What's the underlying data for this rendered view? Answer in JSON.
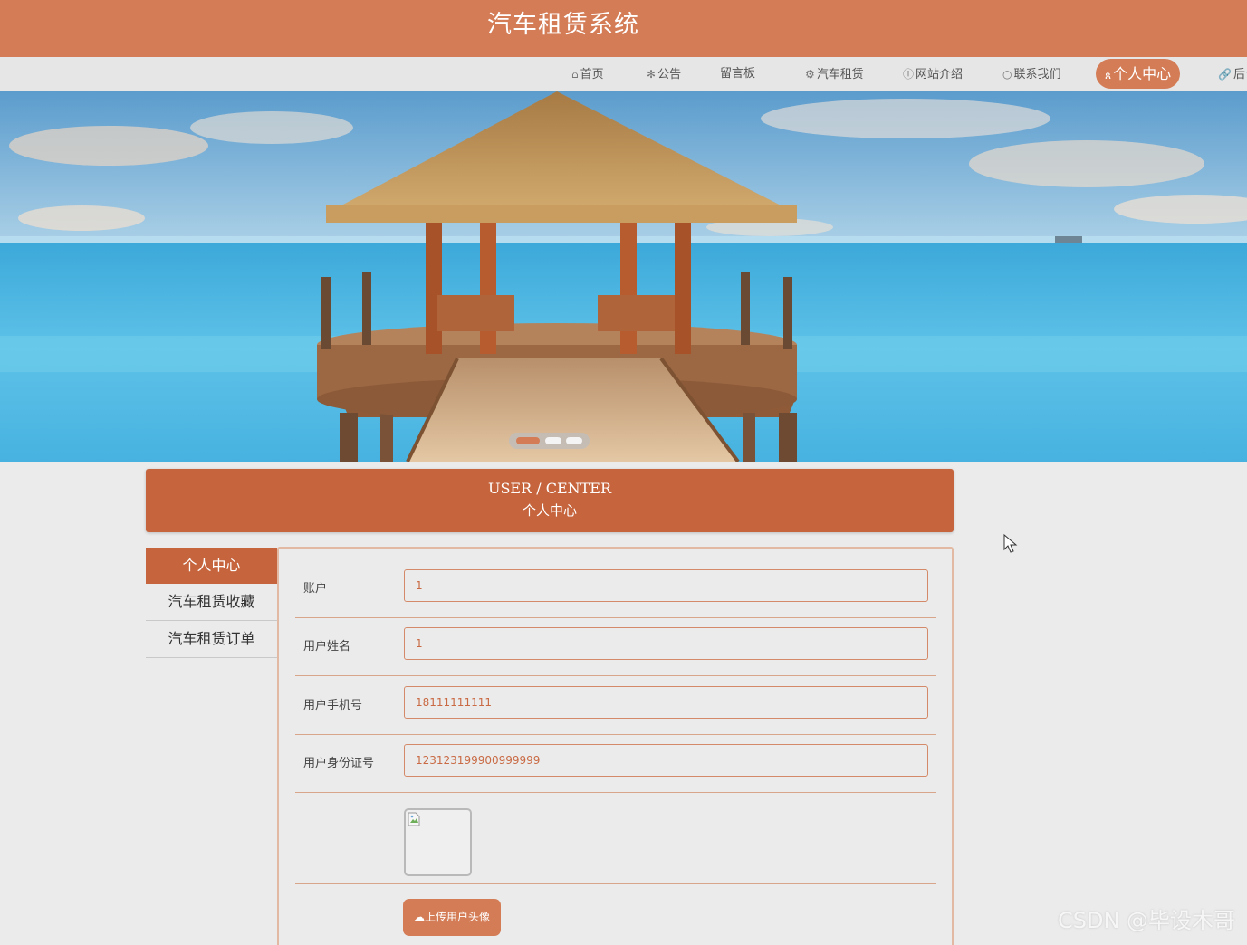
{
  "header": {
    "site_title": "汽车租赁系统"
  },
  "nav": {
    "items": [
      {
        "icon": "home-icon",
        "glyph": "⌂",
        "label": "首页"
      },
      {
        "icon": "notice-icon",
        "glyph": "✻",
        "label": "公告"
      },
      {
        "icon": "message-icon",
        "glyph": "",
        "label": "留言板"
      },
      {
        "icon": "car-icon",
        "glyph": "⚙",
        "label": "汽车租赁"
      },
      {
        "icon": "info-icon",
        "glyph": "ⓘ",
        "label": "网站介绍"
      },
      {
        "icon": "contact-icon",
        "glyph": "○",
        "label": "联系我们"
      },
      {
        "icon": "user-icon",
        "glyph": "ጰ",
        "label": "个人中心"
      },
      {
        "icon": "link-icon",
        "glyph": "🔗",
        "label": "后台"
      }
    ],
    "active_index": 6
  },
  "carousel": {
    "slide_count": 3,
    "active_slide": 1
  },
  "user_center": {
    "title_en": "USER / CENTER",
    "title_cn": "个人中心"
  },
  "sidebar": {
    "items": [
      {
        "label": "个人中心",
        "active": true
      },
      {
        "label": "汽车租赁收藏",
        "active": false
      },
      {
        "label": "汽车租赁订单",
        "active": false
      }
    ]
  },
  "form": {
    "fields": [
      {
        "label": "账户",
        "value": "1"
      },
      {
        "label": "用户姓名",
        "value": "1"
      },
      {
        "label": "用户手机号",
        "value": "18111111111"
      },
      {
        "label": "用户身份证号",
        "value": "123123199900999999"
      }
    ],
    "upload_button": "上传用户头像"
  },
  "watermark": "CSDN @毕设木哥",
  "colors": {
    "primary": "#d47c56",
    "primary_dark": "#c5643d",
    "background": "#ebebeb"
  }
}
